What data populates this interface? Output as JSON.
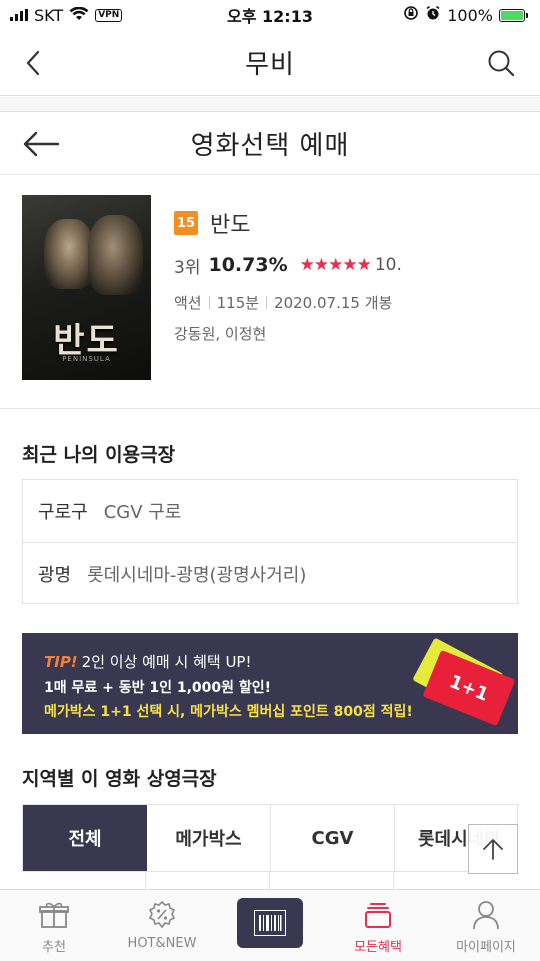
{
  "status_bar": {
    "carrier": "SKT",
    "vpn": "VPN",
    "time": "오후 12:13",
    "battery": "100%"
  },
  "header": {
    "title": "무비",
    "back_icon": "chevron-left-icon",
    "search_icon": "search-icon"
  },
  "sub_header": {
    "title": "영화선택 예매",
    "back_icon": "arrow-left-icon"
  },
  "movie": {
    "poster": {
      "top_text": "",
      "title": "반도",
      "tag": "",
      "sub": "PENINSULA"
    },
    "age_rating": "15",
    "title": "반도",
    "rank": "3위",
    "rate": "10.73%",
    "stars": "★★★★★",
    "score": "10.",
    "genre": "액션",
    "runtime": "115분",
    "release": "2020.07.15 개봉",
    "cast": "강동원, 이정현"
  },
  "recent": {
    "title": "최근 나의 이용극장",
    "items": [
      {
        "area": "구로구",
        "name": "CGV 구로"
      },
      {
        "area": "광명",
        "name": "롯데시네마-광명(광명사거리)"
      }
    ]
  },
  "banner": {
    "tip": "TIP!",
    "line1": "2인 이상 예매 시 혜택 UP!",
    "line2": "1매 무료 + 동반 1인 1,000원 할인!",
    "line3": "메가박스 1+1 선택 시, 메가박스 멤버십 포인트 800점 적립!",
    "ticket_text": "1+1"
  },
  "theaters": {
    "title": "지역별 이 영화 상영극장",
    "tabs": [
      "전체",
      "메가박스",
      "CGV",
      "롯데시네마"
    ]
  },
  "bottom_nav": {
    "items": [
      {
        "label": "추천",
        "icon": "gift-icon"
      },
      {
        "label": "HOT&NEW",
        "icon": "percent-badge-icon"
      },
      {
        "label": "",
        "icon": "barcode-icon"
      },
      {
        "label": "모든혜택",
        "icon": "ticket-stack-icon"
      },
      {
        "label": "마이페이지",
        "icon": "person-icon"
      }
    ]
  },
  "colors": {
    "accent": "#e5304f",
    "navy": "#3a3850",
    "age_badge": "#f38f1f",
    "tip": "#f0813c",
    "highlight_yellow": "#f5e04a"
  }
}
